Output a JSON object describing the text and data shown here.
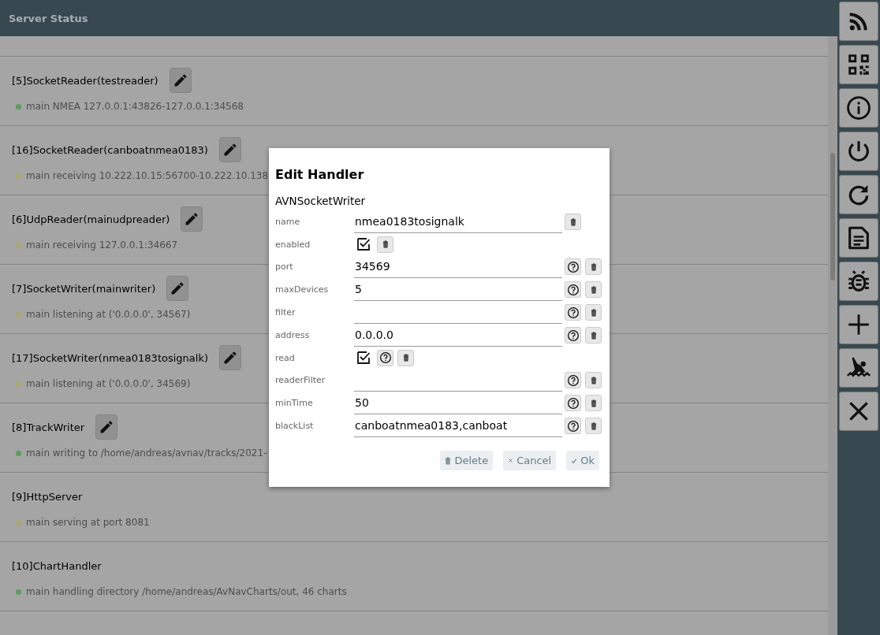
{
  "header": {
    "title": "Server Status"
  },
  "handlers": [
    {
      "title": "[5]SocketReader(testreader)",
      "editable": true,
      "status": {
        "text": "main NMEA 127.0.0.1:43826-127.0.0.1:34568",
        "color": "#5c9c5c"
      }
    },
    {
      "title": "[16]SocketReader(canboatnmea0183)",
      "editable": true,
      "status": {
        "text": "main receiving 10.222.10.15:56700-10.222.10.138",
        "color": "#aaa86c"
      }
    },
    {
      "title": "[6]UdpReader(mainudpreader)",
      "editable": true,
      "status": {
        "text": "main receiving 127.0.0.1:34667",
        "color": "#aaa86c"
      }
    },
    {
      "title": "[7]SocketWriter(mainwriter)",
      "editable": true,
      "status": {
        "text": "main listening at ('0.0.0.0', 34567)",
        "color": "#aaa86c"
      }
    },
    {
      "title": "[17]SocketWriter(nmea0183tosignalk)",
      "editable": true,
      "status": {
        "text": "main listening at ('0.0.0.0', 34569)",
        "color": "#aaa86c"
      }
    },
    {
      "title": "[8]TrackWriter",
      "editable": true,
      "status": {
        "text": "main writing to /home/andreas/avnav/tracks/2021-",
        "color": "#5c9c5c"
      }
    },
    {
      "title": "[9]HttpServer",
      "editable": false,
      "status": {
        "text": "main serving at port 8081",
        "color": "#aaa86c"
      }
    },
    {
      "title": "[10]ChartHandler",
      "editable": false,
      "status": {
        "text": "main handling directory /home/andreas/AvNavCharts/out, 46 charts",
        "color": "#5c9c5c"
      }
    }
  ],
  "dialog": {
    "title": "Edit Handler",
    "subtitle": "AVNSocketWriter",
    "fields": [
      {
        "kind": "text",
        "label": "name",
        "value": "nmea0183tosignalk",
        "help": false
      },
      {
        "kind": "checkbox",
        "label": "enabled",
        "checked": true,
        "help": false
      },
      {
        "kind": "text",
        "label": "port",
        "value": "34569",
        "help": true
      },
      {
        "kind": "text",
        "label": "maxDevices",
        "value": "5",
        "help": true
      },
      {
        "kind": "text",
        "label": "filter",
        "help": true
      },
      {
        "kind": "text",
        "label": "address",
        "value": "0.0.0.0",
        "help": true
      },
      {
        "kind": "checkbox",
        "label": "read",
        "checked": true,
        "help": true
      },
      {
        "kind": "text",
        "label": "readerFilter",
        "help": true
      },
      {
        "kind": "text",
        "label": "minTime",
        "value": "50",
        "help": true
      },
      {
        "kind": "text",
        "label": "blackList",
        "value": "canboatnmea0183,canboat",
        "help": true
      }
    ],
    "buttons": [
      {
        "kind": "delete",
        "label": "Delete"
      },
      {
        "kind": "cancel",
        "label": "Cancel"
      },
      {
        "kind": "ok",
        "label": "Ok"
      }
    ]
  }
}
